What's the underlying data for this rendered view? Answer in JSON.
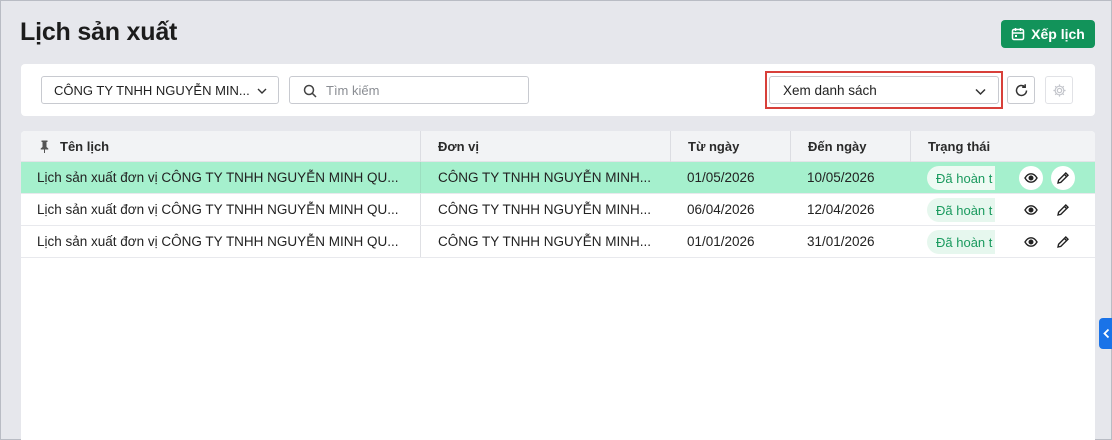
{
  "page": {
    "title": "Lịch sản xuất"
  },
  "toolbar": {
    "schedule_label": "Xếp lịch"
  },
  "filters": {
    "company": "CÔNG TY TNHH NGUYỄN MIN...",
    "search_placeholder": "Tìm kiếm",
    "view_mode": "Xem danh sách"
  },
  "table": {
    "headers": {
      "name": "Tên lịch",
      "unit": "Đơn vị",
      "from": "Từ ngày",
      "to": "Đến ngày",
      "status": "Trạng thái"
    },
    "rows": [
      {
        "name": "Lịch sản xuất đơn vị CÔNG TY TNHH NGUYỄN MINH QU...",
        "unit": "CÔNG TY TNHH NGUYỄN MINH...",
        "from": "01/05/2026",
        "to": "10/05/2026",
        "status": "Đã hoàn t"
      },
      {
        "name": "Lịch sản xuất đơn vị CÔNG TY TNHH NGUYỄN MINH QU...",
        "unit": "CÔNG TY TNHH NGUYỄN MINH...",
        "from": "06/04/2026",
        "to": "12/04/2026",
        "status": "Đã hoàn t"
      },
      {
        "name": "Lịch sản xuất đơn vị CÔNG TY TNHH NGUYỄN MINH QU...",
        "unit": "CÔNG TY TNHH NGUYỄN MINH...",
        "from": "01/01/2026",
        "to": "31/01/2026",
        "status": "Đã hoàn t"
      }
    ]
  },
  "colors": {
    "primary_green": "#12935a",
    "selected_row": "#a5f0cd",
    "status_text": "#1a9a5e",
    "highlight_border": "#d8403a",
    "side_tab": "#1a73e8"
  },
  "icons": {
    "schedule": "calendar-icon",
    "company_dropdown": "chevron-down-icon",
    "search": "search-icon",
    "view_dropdown": "chevron-down-icon",
    "refresh": "refresh-icon",
    "settings": "gear-icon",
    "pin": "pin-icon",
    "view": "eye-icon",
    "edit": "pencil-icon",
    "side_tab": "chevron-left-icon"
  }
}
